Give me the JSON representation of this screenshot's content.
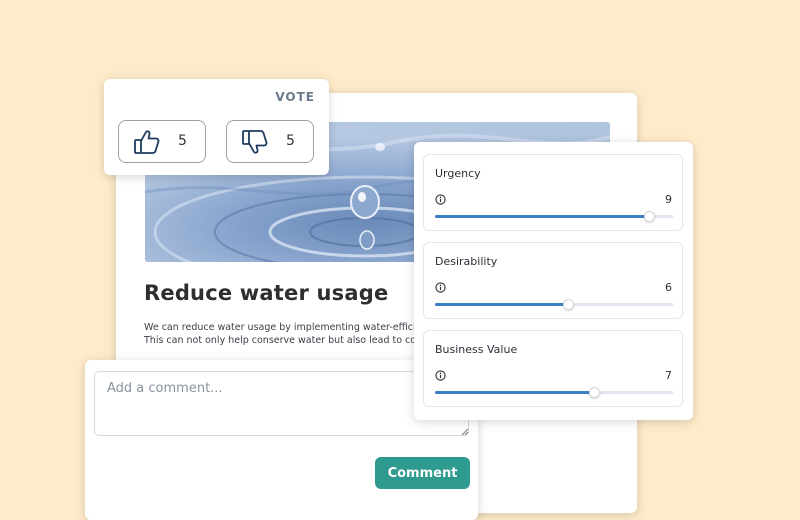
{
  "idea": {
    "title": "Reduce water usage",
    "description": "We can reduce water usage by implementing water-efficient fixtures and minimizing waste water. This can not only help conserve water but also lead to cost savings"
  },
  "vote": {
    "heading": "VOTE",
    "upvotes": "5",
    "downvotes": "5",
    "icon_up": "thumbs-up-icon",
    "icon_down": "thumbs-down-icon"
  },
  "comment": {
    "placeholder": "Add a comment...",
    "button_label": "Comment",
    "button_color": "#2f9a8f"
  },
  "ratings": [
    {
      "label": "Urgency",
      "value": "9",
      "level": 0.9
    },
    {
      "label": "Desirability",
      "value": "6",
      "level": 0.56
    },
    {
      "label": "Business Value",
      "value": "7",
      "level": 0.67
    }
  ],
  "colors": {
    "background": "#fdebc9",
    "slider_accent": "#3d7ec4"
  }
}
